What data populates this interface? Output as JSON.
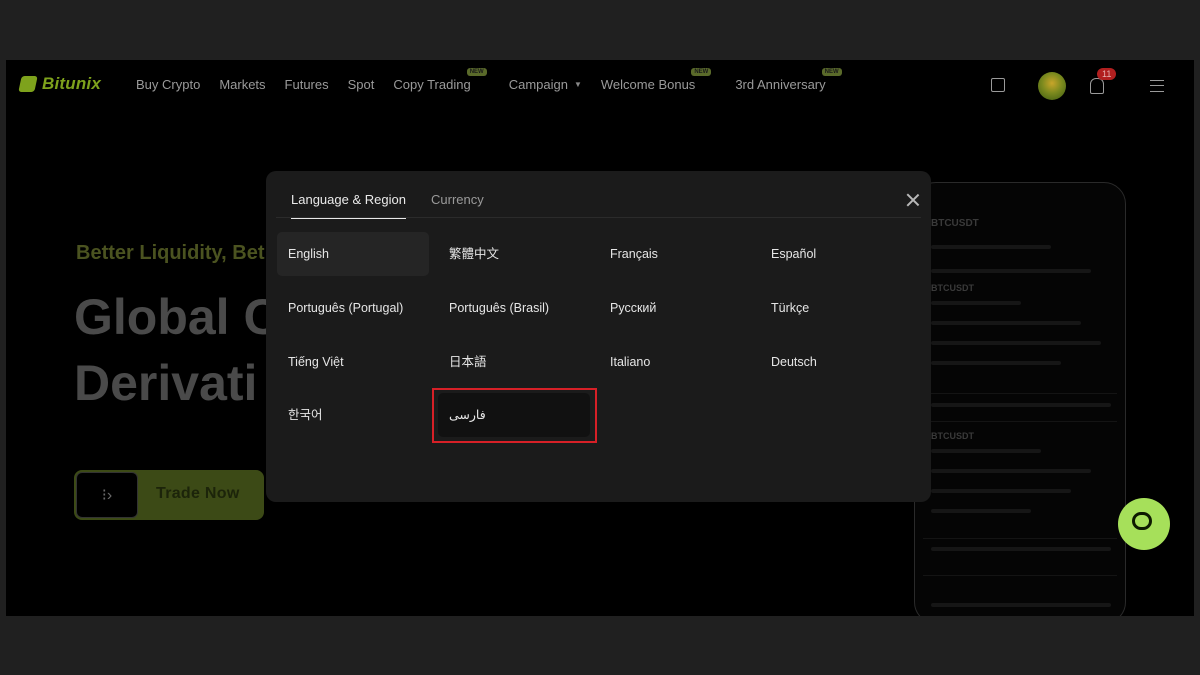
{
  "brand": {
    "name": "Bitunix",
    "accent": "#7ea21c"
  },
  "nav": {
    "items": [
      {
        "label": "Buy Crypto",
        "badge": ""
      },
      {
        "label": "Markets",
        "badge": ""
      },
      {
        "label": "Futures",
        "badge": ""
      },
      {
        "label": "Spot",
        "badge": ""
      },
      {
        "label": "Copy Trading",
        "badge": "NEW"
      },
      {
        "label": "Campaign",
        "badge": "",
        "dropdown": true
      },
      {
        "label": "Welcome Bonus",
        "badge": "NEW"
      },
      {
        "label": "3rd Anniversary",
        "badge": "NEW"
      }
    ],
    "notification_count": "11",
    "icons": [
      "wallet-icon",
      "avatar",
      "bell-icon",
      "hamburger-icon"
    ]
  },
  "hero": {
    "subtitle": "Better Liquidity, Bet",
    "title_line1": "Global C",
    "title_line2": "Derivati",
    "cta_label": "Trade Now"
  },
  "phone_preview": {
    "pair": "BTCUSDT",
    "symbols": [
      "BTCUSDT",
      "BTCUSDT"
    ]
  },
  "modal": {
    "tabs": [
      {
        "label": "Language & Region",
        "active": true
      },
      {
        "label": "Currency",
        "active": false
      }
    ],
    "languages": [
      {
        "label": "English",
        "selected": true
      },
      {
        "label": "繁體中文",
        "selected": false
      },
      {
        "label": "Français",
        "selected": false
      },
      {
        "label": "Español",
        "selected": false
      },
      {
        "label": "Português (Portugal)",
        "selected": false
      },
      {
        "label": "Português (Brasil)",
        "selected": false
      },
      {
        "label": "Русский",
        "selected": false
      },
      {
        "label": "Türkçe",
        "selected": false
      },
      {
        "label": "Tiếng Việt",
        "selected": false
      },
      {
        "label": "日本語",
        "selected": false
      },
      {
        "label": "Italiano",
        "selected": false
      },
      {
        "label": "Deutsch",
        "selected": false
      },
      {
        "label": "한국어",
        "selected": false
      },
      {
        "label": "فارسی",
        "selected": false,
        "highlighted": true
      }
    ],
    "highlight_color": "#d72027"
  },
  "chat": {
    "icon": "chat-bubble-icon",
    "color": "#a6e05a"
  }
}
